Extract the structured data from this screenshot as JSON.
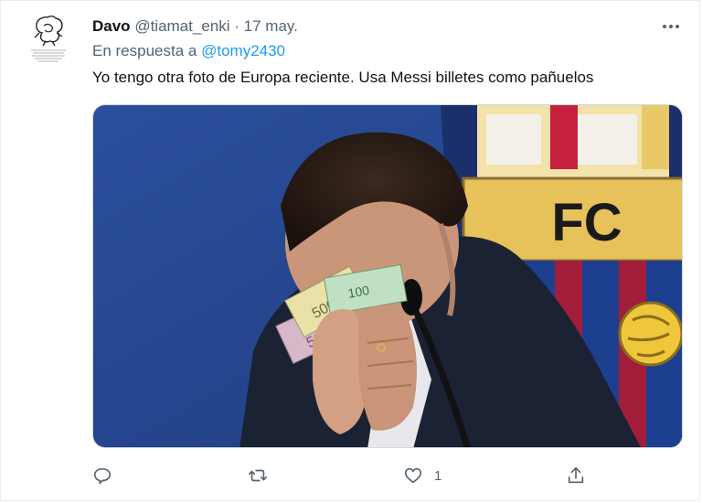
{
  "tweet": {
    "display_name": "Davo",
    "handle": "@tiamat_enki",
    "separator": "·",
    "date": "17 may.",
    "reply_prefix": "En respuesta a",
    "reply_to": "@tomy2430",
    "text": "Yo tengo otra foto de Europa reciente. Usa Messi billetes como pañuelos",
    "media": {
      "badge_letters": "FC",
      "banknote_values": [
        "500",
        "500",
        "100"
      ]
    },
    "actions": {
      "reply_icon": "reply-icon",
      "retweet_icon": "retweet-icon",
      "like_icon": "heart-icon",
      "like_count": "1",
      "share_icon": "share-icon"
    },
    "colors": {
      "link": "#1d9bf0",
      "secondary_text": "#536471",
      "primary_text": "#0f1419"
    }
  }
}
